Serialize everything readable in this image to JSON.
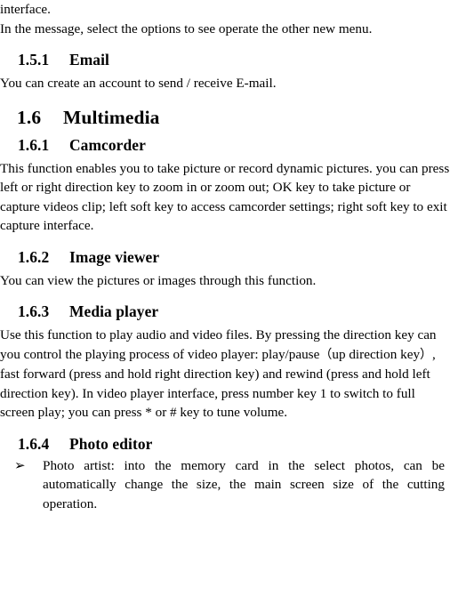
{
  "document": {
    "paragraphs": {
      "intro_tail": "interface.",
      "intro_body": "In the message, select the options to see operate the other new menu.",
      "email_body": "You can create an account to send / receive E-mail.",
      "camcorder_body": "This function enables you to take picture or record dynamic pictures. you can press left or right direction key to zoom in or zoom out; OK key to take picture or capture videos clip; left soft key to access camcorder settings; right soft key to exit capture interface.",
      "image_viewer_body": "You can view the pictures or images through this function.",
      "media_player_body_a": "Use this function to play audio and video files. By pressing the direction key can you control the playing process of video player: play/pause",
      "media_player_paren_open": "（",
      "media_player_paren_text": "up direction key",
      "media_player_paren_close": "）",
      "media_player_body_b": ", fast forward (press and hold right direction key) and rewind (press and hold left direction key). In video player interface, press number key 1 to switch to full screen play; you can press * or # key to tune volume."
    },
    "headings": {
      "email": {
        "number": "1.5.1",
        "title": "Email"
      },
      "multimedia": {
        "number": "1.6",
        "title": "Multimedia"
      },
      "camcorder": {
        "number": "1.6.1",
        "title": "Camcorder"
      },
      "image_viewer": {
        "number": "1.6.2",
        "title": "Image viewer"
      },
      "media_player": {
        "number": "1.6.3",
        "title": "Media player"
      },
      "photo_editor": {
        "number": "1.6.4",
        "title": "Photo editor"
      }
    },
    "bullets": [
      {
        "marker": "➢",
        "text": "Photo artist: into the memory card in the select photos, can be automatically change the size, the main screen size of the cutting operation."
      }
    ]
  }
}
